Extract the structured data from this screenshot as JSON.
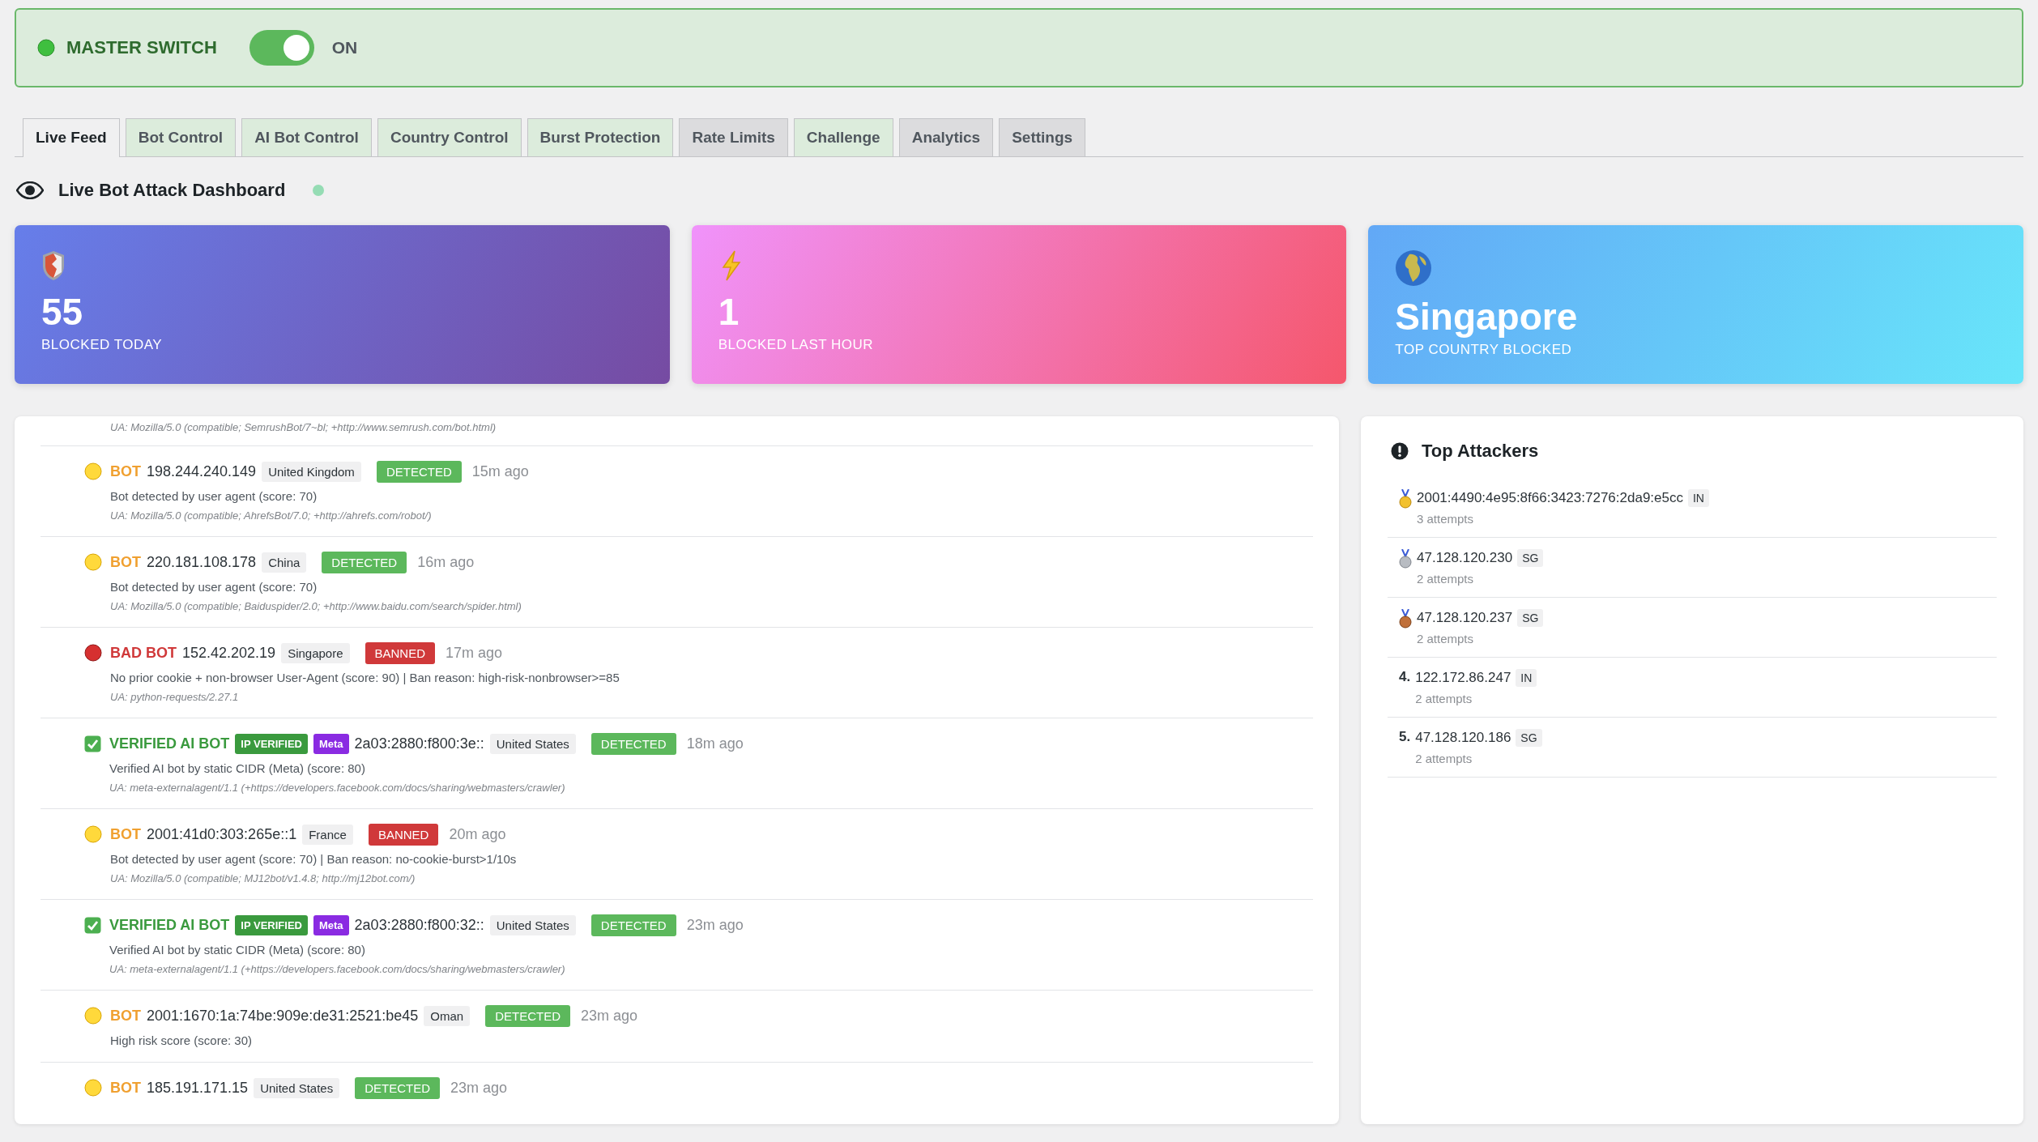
{
  "master": {
    "label": "MASTER SWITCH",
    "on": true,
    "state_text": "ON"
  },
  "tabs": [
    {
      "label": "Live Feed",
      "selected": true,
      "color": "#f0f0f1"
    },
    {
      "label": "Bot Control",
      "selected": false,
      "color": "#dcecdc"
    },
    {
      "label": "AI Bot Control",
      "selected": false,
      "color": "#dcecdc"
    },
    {
      "label": "Country Control",
      "selected": false,
      "color": "#dcecdc"
    },
    {
      "label": "Burst Protection",
      "selected": false,
      "color": "#dcecdc"
    },
    {
      "label": "Rate Limits",
      "selected": false,
      "color": "#dcdcde"
    },
    {
      "label": "Challenge",
      "selected": false,
      "color": "#dcecdc"
    },
    {
      "label": "Analytics",
      "selected": false,
      "color": "#dcdcde"
    },
    {
      "label": "Settings",
      "selected": false,
      "color": "#dcdcde"
    }
  ],
  "heading": "Live Bot Attack Dashboard",
  "stats": [
    {
      "kind": "shield",
      "value": "55",
      "label": "BLOCKED TODAY"
    },
    {
      "kind": "bolt",
      "value": "1",
      "label": "BLOCKED LAST HOUR"
    },
    {
      "kind": "globe",
      "value": "Singapore",
      "label": "TOP COUNTRY BLOCKED"
    }
  ],
  "feed": {
    "top_fragment": "UA: Mozilla/5.0 (compatible; SemrushBot/7~bl; +http://www.semrush.com/bot.html)",
    "entries": [
      {
        "kind": "bot",
        "type_label": "BOT",
        "ip": "198.244.240.149",
        "country": "United Kingdom",
        "status": {
          "label": "DETECTED",
          "color": "#5cb85c"
        },
        "time": "15m ago",
        "description": "Bot detected by user agent (score: 70)",
        "ua": "UA: Mozilla/5.0 (compatible; AhrefsBot/7.0; +http://ahrefs.com/robot/)"
      },
      {
        "kind": "bot",
        "type_label": "BOT",
        "ip": "220.181.108.178",
        "country": "China",
        "status": {
          "label": "DETECTED",
          "color": "#5cb85c"
        },
        "time": "16m ago",
        "description": "Bot detected by user agent (score: 70)",
        "ua": "UA: Mozilla/5.0 (compatible; Baiduspider/2.0; +http://www.baidu.com/search/spider.html)"
      },
      {
        "kind": "bad_bot",
        "type_label": "BAD BOT",
        "ip": "152.42.202.19",
        "country": "Singapore",
        "status": {
          "label": "BANNED",
          "color": "#d0393a"
        },
        "time": "17m ago",
        "description": "No prior cookie + non-browser User-Agent (score: 90) | Ban reason: high-risk-nonbrowser>=85",
        "ua": "UA: python-requests/2.27.1"
      },
      {
        "kind": "verified",
        "type_label": "VERIFIED AI BOT",
        "tags": [
          "IP VERIFIED",
          "Meta"
        ],
        "ip": "2a03:2880:f800:3e::",
        "country": "United States",
        "status": {
          "label": "DETECTED",
          "color": "#5cb85c"
        },
        "time": "18m ago",
        "description": "Verified AI bot by static CIDR (Meta) (score: 80)",
        "ua": "UA: meta-externalagent/1.1 (+https://developers.facebook.com/docs/sharing/webmasters/crawler)"
      },
      {
        "kind": "bot",
        "type_label": "BOT",
        "ip": "2001:41d0:303:265e::1",
        "country": "France",
        "status": {
          "label": "BANNED",
          "color": "#d0393a"
        },
        "time": "20m ago",
        "description": "Bot detected by user agent (score: 70) | Ban reason: no-cookie-burst>1/10s",
        "ua": "UA: Mozilla/5.0 (compatible; MJ12bot/v1.4.8; http://mj12bot.com/)"
      },
      {
        "kind": "verified",
        "type_label": "VERIFIED AI BOT",
        "tags": [
          "IP VERIFIED",
          "Meta"
        ],
        "ip": "2a03:2880:f800:32::",
        "country": "United States",
        "status": {
          "label": "DETECTED",
          "color": "#5cb85c"
        },
        "time": "23m ago",
        "description": "Verified AI bot by static CIDR (Meta) (score: 80)",
        "ua": "UA: meta-externalagent/1.1 (+https://developers.facebook.com/docs/sharing/webmasters/crawler)"
      },
      {
        "kind": "bot",
        "type_label": "BOT",
        "ip": "2001:1670:1a:74be:909e:de31:2521:be45",
        "country": "Oman",
        "status": {
          "label": "DETECTED",
          "color": "#5cb85c"
        },
        "time": "23m ago",
        "description": "High risk score (score: 30)"
      },
      {
        "kind": "bot",
        "type_label": "BOT",
        "ip": "185.191.171.15",
        "country": "United States",
        "status": {
          "label": "DETECTED",
          "color": "#5cb85c"
        },
        "time": "23m ago"
      }
    ]
  },
  "top_attackers": {
    "title": "Top Attackers",
    "items": [
      {
        "kind": "gold",
        "ip": "2001:4490:4e95:8f66:3423:7276:2da9:e5cc",
        "country": "IN",
        "attempts": "3 attempts"
      },
      {
        "kind": "silver",
        "ip": "47.128.120.230",
        "country": "SG",
        "attempts": "2 attempts"
      },
      {
        "kind": "bronze",
        "ip": "47.128.120.237",
        "country": "SG",
        "attempts": "2 attempts"
      },
      {
        "kind": "number",
        "rank": "4.",
        "ip": "122.172.86.247",
        "country": "IN",
        "attempts": "2 attempts"
      },
      {
        "kind": "number",
        "rank": "5.",
        "ip": "47.128.120.186",
        "country": "SG",
        "attempts": "2 attempts"
      }
    ]
  }
}
